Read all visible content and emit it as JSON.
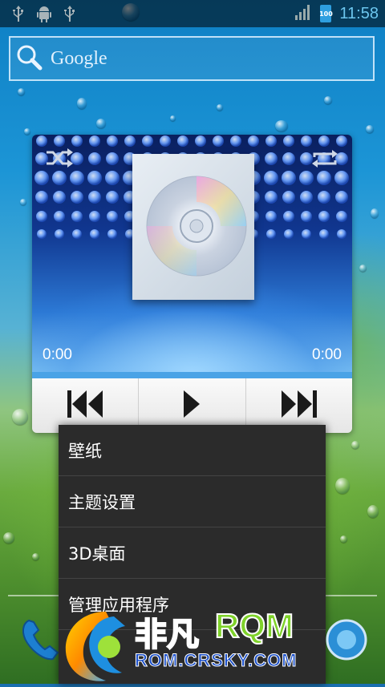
{
  "status_bar": {
    "time": "11:58",
    "battery_label": "100",
    "icons": [
      "usb-icon",
      "android-debug-icon",
      "usb-icon",
      "signal-icon",
      "battery-icon"
    ]
  },
  "search": {
    "label": "Google"
  },
  "music": {
    "elapsed": "0:00",
    "duration": "0:00"
  },
  "menu": {
    "items": [
      "壁纸",
      "主题设置",
      "3D桌面",
      "管理应用程序"
    ]
  },
  "watermark": {
    "brand_cn": "非凡",
    "brand_en": "RQM",
    "url": "ROM.CRSKY.COM"
  }
}
